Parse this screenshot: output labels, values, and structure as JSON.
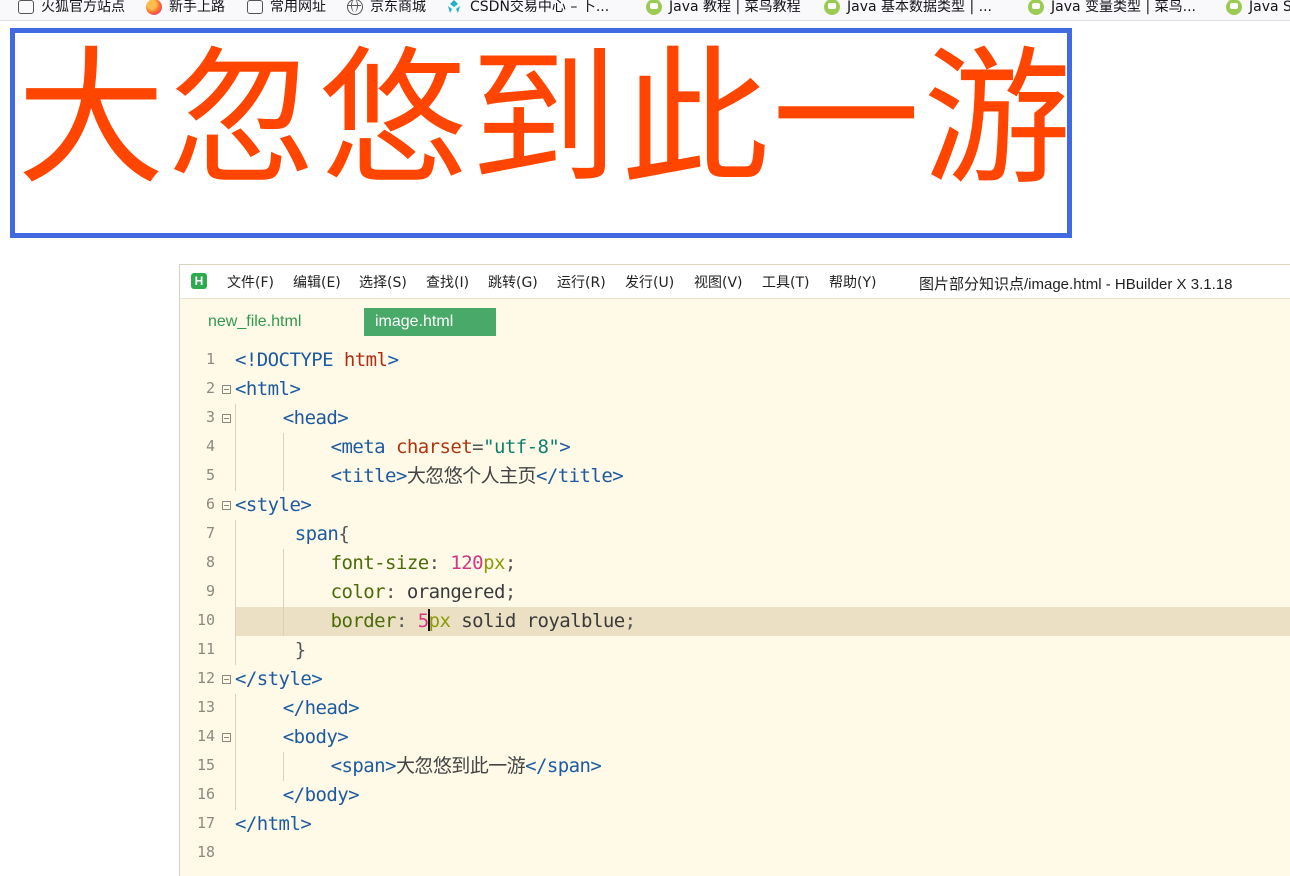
{
  "bookmarks": [
    {
      "icon": "folder-icon",
      "label": "火狐官方站点"
    },
    {
      "icon": "firefox-icon",
      "label": "新手上路"
    },
    {
      "icon": "folder-icon",
      "label": "常用网址"
    },
    {
      "icon": "globe-icon",
      "label": "京东商城"
    },
    {
      "icon": "csdn-icon",
      "label": "CSDN交易中心 – 卜..."
    },
    {
      "icon": "runoob-icon",
      "label": "Java 教程 | 菜鸟教程"
    },
    {
      "icon": "runoob-icon",
      "label": "Java 基本数据类型 | ..."
    },
    {
      "icon": "runoob-icon",
      "label": "Java 变量类型 | 菜鸟..."
    },
    {
      "icon": "runoob-icon",
      "label": "Java S"
    }
  ],
  "rendered": {
    "text": "大忽悠到此一游",
    "color": "#ff4500",
    "border_color": "#4169e1"
  },
  "editor": {
    "logo": "H",
    "menu": [
      "文件(F)",
      "编辑(E)",
      "选择(S)",
      "查找(I)",
      "跳转(G)",
      "运行(R)",
      "发行(U)",
      "视图(V)",
      "工具(T)",
      "帮助(Y)"
    ],
    "window_title": "图片部分知识点/image.html - HBuilder X 3.1.18",
    "tabs": [
      {
        "label": "new_file.html",
        "active": false
      },
      {
        "label": "image.html",
        "active": true
      }
    ],
    "lines": [
      {
        "n": "1",
        "fold": false,
        "indent": 0,
        "tokens": [
          {
            "t": "tag",
            "v": "<!DOCTYPE "
          },
          {
            "t": "kw",
            "v": "html"
          },
          {
            "t": "tag",
            "v": ">"
          }
        ]
      },
      {
        "n": "2",
        "fold": true,
        "indent": 0,
        "tokens": [
          {
            "t": "tag",
            "v": "<html>"
          }
        ]
      },
      {
        "n": "3",
        "fold": true,
        "indent": 4,
        "tokens": [
          {
            "t": "tag",
            "v": "<head>"
          }
        ]
      },
      {
        "n": "4",
        "fold": false,
        "indent": 8,
        "tokens": [
          {
            "t": "tag",
            "v": "<meta "
          },
          {
            "t": "attr",
            "v": "charset"
          },
          {
            "t": "punc",
            "v": "="
          },
          {
            "t": "str",
            "v": "\"utf-8\""
          },
          {
            "t": "tag",
            "v": ">"
          }
        ]
      },
      {
        "n": "5",
        "fold": false,
        "indent": 8,
        "tokens": [
          {
            "t": "tag",
            "v": "<title>"
          },
          {
            "t": "text",
            "v": "大忽悠个人主页"
          },
          {
            "t": "tag",
            "v": "</title>"
          }
        ]
      },
      {
        "n": "6",
        "fold": true,
        "indent": 0,
        "tokens": [
          {
            "t": "tag",
            "v": "<style>"
          }
        ]
      },
      {
        "n": "7",
        "fold": false,
        "indent": 5,
        "tokens": [
          {
            "t": "sel",
            "v": "span"
          },
          {
            "t": "punc",
            "v": "{"
          }
        ]
      },
      {
        "n": "8",
        "fold": false,
        "indent": 8,
        "tokens": [
          {
            "t": "prop",
            "v": "font-size"
          },
          {
            "t": "punc",
            "v": ": "
          },
          {
            "t": "num",
            "v": "120"
          },
          {
            "t": "unit",
            "v": "px"
          },
          {
            "t": "punc",
            "v": ";"
          }
        ]
      },
      {
        "n": "9",
        "fold": false,
        "indent": 8,
        "tokens": [
          {
            "t": "prop",
            "v": "color"
          },
          {
            "t": "punc",
            "v": ": "
          },
          {
            "t": "val",
            "v": "orangered"
          },
          {
            "t": "punc",
            "v": ";"
          }
        ]
      },
      {
        "n": "10",
        "fold": false,
        "indent": 8,
        "current": true,
        "tokens": [
          {
            "t": "prop",
            "v": "border"
          },
          {
            "t": "punc",
            "v": ": "
          },
          {
            "t": "num",
            "v": "5"
          },
          {
            "t": "caret",
            "v": ""
          },
          {
            "t": "unit",
            "v": "px"
          },
          {
            "t": "val",
            "v": " solid royalblue"
          },
          {
            "t": "punc",
            "v": ";"
          }
        ]
      },
      {
        "n": "11",
        "fold": false,
        "indent": 5,
        "tokens": [
          {
            "t": "punc",
            "v": "}"
          }
        ]
      },
      {
        "n": "12",
        "fold": true,
        "indent": 0,
        "tokens": [
          {
            "t": "tag",
            "v": "</style>"
          }
        ]
      },
      {
        "n": "13",
        "fold": false,
        "indent": 4,
        "tokens": [
          {
            "t": "tag",
            "v": "</head>"
          }
        ]
      },
      {
        "n": "14",
        "fold": true,
        "indent": 4,
        "tokens": [
          {
            "t": "tag",
            "v": "<body>"
          }
        ]
      },
      {
        "n": "15",
        "fold": false,
        "indent": 8,
        "tokens": [
          {
            "t": "tag",
            "v": "<span>"
          },
          {
            "t": "text",
            "v": "大忽悠到此一游"
          },
          {
            "t": "tag",
            "v": "</span>"
          }
        ]
      },
      {
        "n": "16",
        "fold": false,
        "indent": 4,
        "tokens": [
          {
            "t": "tag",
            "v": "</body>"
          }
        ]
      },
      {
        "n": "17",
        "fold": false,
        "indent": 0,
        "tokens": [
          {
            "t": "tag",
            "v": "</html>"
          }
        ]
      },
      {
        "n": "18",
        "fold": false,
        "indent": 0,
        "tokens": []
      }
    ]
  }
}
